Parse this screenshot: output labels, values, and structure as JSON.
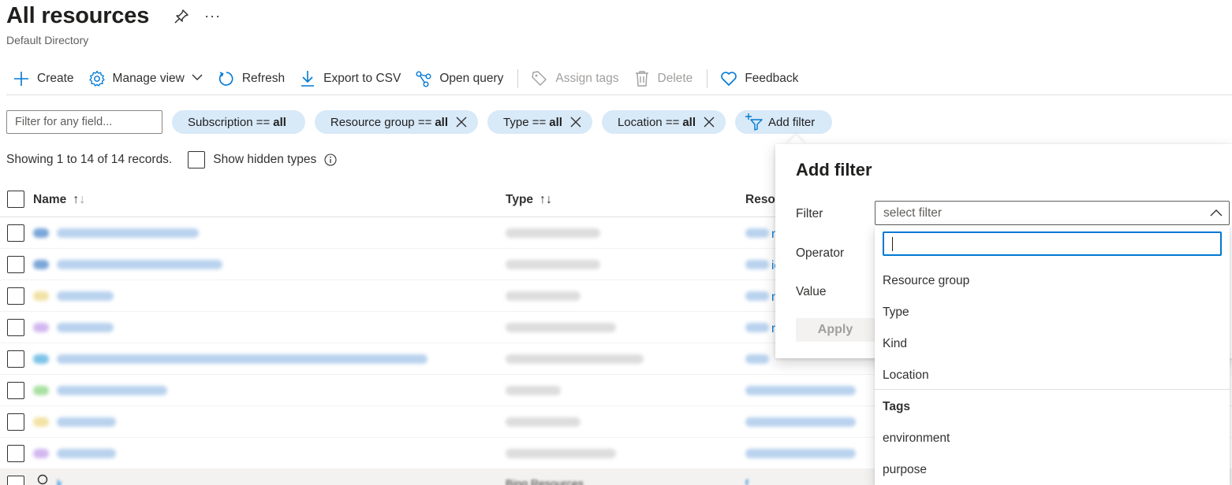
{
  "header": {
    "title": "All resources",
    "subtitle": "Default Directory",
    "more_label": "···"
  },
  "toolbar": {
    "create": "Create",
    "manage_view": "Manage view",
    "refresh": "Refresh",
    "export": "Export to CSV",
    "open_query": "Open query",
    "assign_tags": "Assign tags",
    "delete": "Delete",
    "feedback": "Feedback"
  },
  "filters": {
    "search_placeholder": "Filter for any field...",
    "pills": [
      {
        "label": "Subscription ==",
        "value": "all"
      },
      {
        "label": "Resource group ==",
        "value": "all"
      },
      {
        "label": "Type ==",
        "value": "all"
      },
      {
        "label": "Location ==",
        "value": "all"
      }
    ],
    "add_filter": "Add filter"
  },
  "records": {
    "summary": "Showing 1 to 14 of 14 records.",
    "show_hidden": "Show hidden types"
  },
  "table": {
    "columns": {
      "name": "Name",
      "type": "Type",
      "resource_group": "Resou"
    },
    "sort_arrows": "↑↓",
    "peek_letters": [
      "n",
      "ic",
      "n",
      "n"
    ],
    "last_row_partial": [
      "k",
      "Bing Resources",
      "f"
    ]
  },
  "add_filter_panel": {
    "title": "Add filter",
    "filter_label": "Filter",
    "operator_label": "Operator",
    "value_label": "Value",
    "apply": "Apply",
    "select_placeholder": "select filter",
    "options": [
      "Resource group",
      "Type",
      "Kind",
      "Location"
    ],
    "tags_group": "Tags",
    "tag_options": [
      "environment",
      "purpose"
    ]
  },
  "colors": {
    "accent": "#0078d4",
    "pill_bg": "#d8e9f8",
    "text": "#323130",
    "disabled": "#a19f9d"
  }
}
